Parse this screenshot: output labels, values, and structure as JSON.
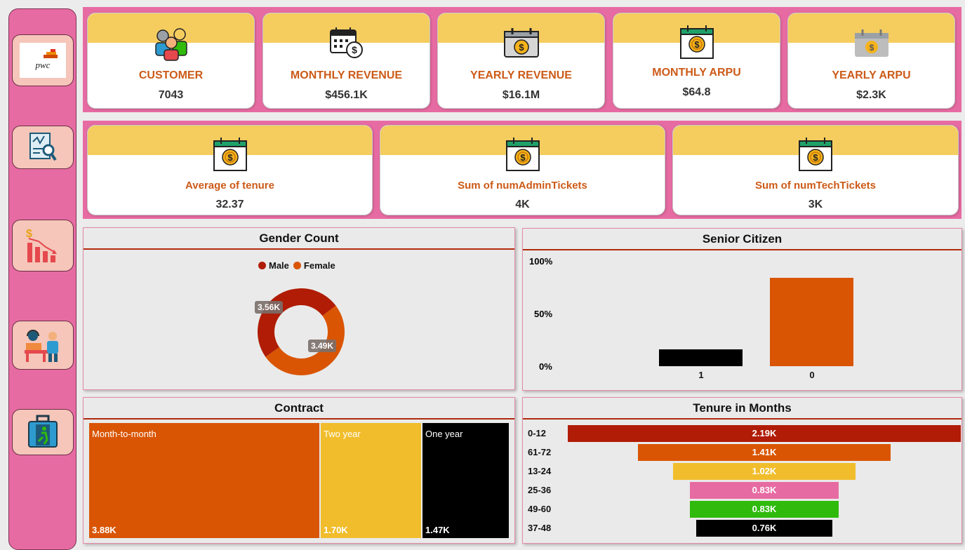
{
  "nav": [
    {
      "icon": "pwc-logo",
      "logo_text": "pwc"
    },
    {
      "icon": "report-search-icon"
    },
    {
      "icon": "revenue-decline-icon"
    },
    {
      "icon": "support-agent-icon"
    },
    {
      "icon": "exit-luggage-icon"
    }
  ],
  "kpi_top": [
    {
      "icon": "customers-icon",
      "label": "CUSTOMER",
      "value": "7043"
    },
    {
      "icon": "calendar-dollar-icon",
      "label": "MONTHLY REVENUE",
      "value": "$456.1K"
    },
    {
      "icon": "calendar-coin-icon",
      "label": "YEARLY REVENUE",
      "value": "$16.1M"
    },
    {
      "icon": "calendar-coin-icon",
      "label": "MONTHLY ARPU",
      "value": "$64.8"
    },
    {
      "icon": "calendar-coin-icon",
      "label": "YEARLY ARPU",
      "value": "$2.3K"
    }
  ],
  "kpi_mid": [
    {
      "icon": "calendar-coin-icon",
      "label": "Average of tenure",
      "value": "32.37"
    },
    {
      "icon": "calendar-coin-icon",
      "label": "Sum of numAdminTickets",
      "value": "4K"
    },
    {
      "icon": "calendar-coin-icon",
      "label": "Sum of numTechTickets",
      "value": "3K"
    }
  ],
  "colors": {
    "accent_pink": "#e76ba3",
    "card_header": "#f5cd5f",
    "label_orange": "#cc5a17",
    "male": "#b01c05",
    "female": "#d95504",
    "title_rule": "#b02a0c"
  },
  "gender": {
    "title": "Gender Count",
    "legend": [
      {
        "name": "Male",
        "color": "#b01c05"
      },
      {
        "name": "Female",
        "color": "#d95504"
      }
    ],
    "labels": {
      "male": "3.56K",
      "female": "3.49K"
    }
  },
  "senior": {
    "title": "Senior Citizen",
    "ticks": [
      "100%",
      "50%",
      "0%"
    ],
    "categories": [
      "1",
      "0"
    ]
  },
  "contract": {
    "title": "Contract",
    "items": [
      {
        "name": "Month-to-month",
        "label": "3.88K",
        "value": 3880,
        "color": "#d95504"
      },
      {
        "name": "Two year",
        "label": "1.70K",
        "value": 1700,
        "color": "#f1bd2c"
      },
      {
        "name": "One year",
        "label": "1.47K",
        "value": 1470,
        "color": "#000000"
      }
    ]
  },
  "tenure": {
    "title": "Tenure in Months",
    "rows": [
      {
        "cat": "0-12",
        "label": "2.19K",
        "value": 2190,
        "color": "#b01c05"
      },
      {
        "cat": "61-72",
        "label": "1.41K",
        "value": 1410,
        "color": "#d95504"
      },
      {
        "cat": "13-24",
        "label": "1.02K",
        "value": 1020,
        "color": "#f1bd2c"
      },
      {
        "cat": "25-36",
        "label": "0.83K",
        "value": 830,
        "color": "#e76ba3"
      },
      {
        "cat": "49-60",
        "label": "0.83K",
        "value": 830,
        "color": "#2fba0c"
      },
      {
        "cat": "37-48",
        "label": "0.76K",
        "value": 760,
        "color": "#000000"
      }
    ]
  },
  "chart_data": [
    {
      "type": "pie",
      "title": "Gender Count",
      "categories": [
        "Male",
        "Female"
      ],
      "values": [
        3560,
        3490
      ],
      "data_labels": [
        "3.56K",
        "3.49K"
      ],
      "legend": "top"
    },
    {
      "type": "bar",
      "title": "Senior Citizen",
      "categories": [
        "1",
        "0"
      ],
      "values": [
        0.16,
        0.84
      ],
      "ylim": [
        0,
        1
      ],
      "y_ticks": [
        "0%",
        "50%",
        "100%"
      ]
    },
    {
      "type": "heatmap",
      "title": "Contract",
      "categories": [
        "Month-to-month",
        "Two year",
        "One year"
      ],
      "values": [
        3880,
        1700,
        1470
      ],
      "data_labels": [
        "3.88K",
        "1.70K",
        "1.47K"
      ]
    },
    {
      "type": "bar",
      "title": "Tenure in Months",
      "categories": [
        "0-12",
        "61-72",
        "13-24",
        "25-36",
        "49-60",
        "37-48"
      ],
      "values": [
        2190,
        1410,
        1020,
        830,
        830,
        760
      ],
      "data_labels": [
        "2.19K",
        "1.41K",
        "1.02K",
        "0.83K",
        "0.83K",
        "0.76K"
      ]
    }
  ]
}
